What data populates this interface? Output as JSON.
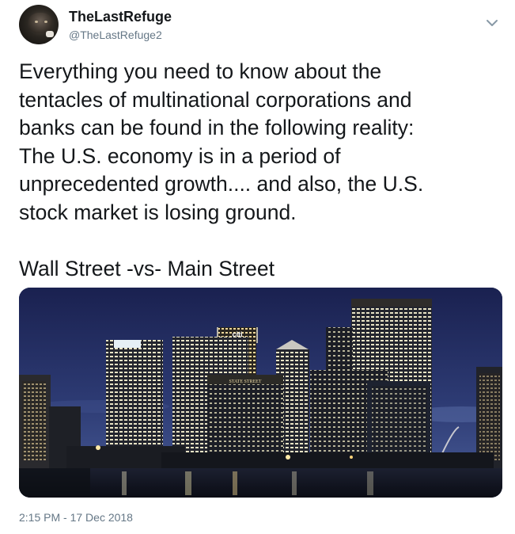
{
  "tweet": {
    "author": {
      "display_name": "TheLastRefuge",
      "handle": "@TheLastRefuge2",
      "avatar_icon": "avatar-photo"
    },
    "menu_icon": "chevron-down-icon",
    "text": "Everything you need to know about the\ntentacles of multinational corporations and\nbanks can be found in the following reality:\nThe U.S. economy is in a period of\nunprecedented growth.... and also, the U.S.\nstock market is losing ground.\n\nWall Street -vs- Main Street",
    "media": {
      "building_signs": [
        "citi",
        "STATE STREET"
      ]
    },
    "timestamp": "2:15 PM - 17 Dec 2018"
  },
  "colors": {
    "text": "#14171a",
    "secondary": "#657786",
    "sky_top": "#1a2150",
    "sky_bottom": "#3b4f8e"
  }
}
